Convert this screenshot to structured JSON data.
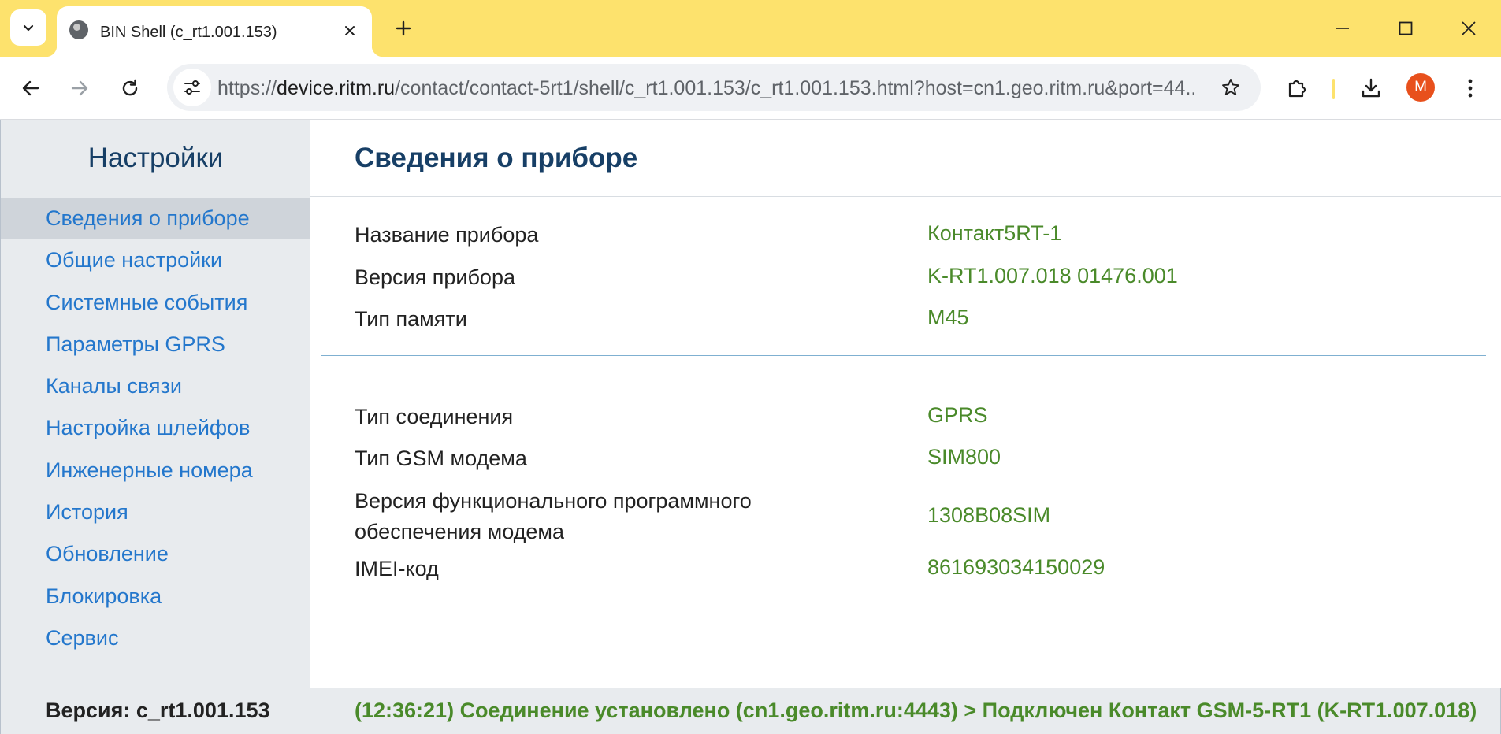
{
  "browser": {
    "tab": {
      "title": "BIN Shell (c_rt1.001.153)"
    },
    "url": {
      "scheme": "https://",
      "host": "device.ritm.ru",
      "path": "/contact/contact-5rt1/shell/c_rt1.001.153/c_rt1.001.153.html?host=cn1.geo.ritm.ru&port=44..."
    },
    "profile_initial": "M",
    "colors": {
      "frame": "#fde26d",
      "avatar": "#e8501c"
    }
  },
  "sidebar": {
    "title": "Настройки",
    "items": [
      {
        "label": "Сведения о приборе",
        "active": true
      },
      {
        "label": "Общие настройки"
      },
      {
        "label": "Системные события"
      },
      {
        "label": "Параметры GPRS"
      },
      {
        "label": "Каналы связи"
      },
      {
        "label": "Настройка шлейфов"
      },
      {
        "label": "Инженерные номера"
      },
      {
        "label": "История"
      },
      {
        "label": "Обновление"
      },
      {
        "label": "Блокировка"
      },
      {
        "label": "Сервис"
      }
    ]
  },
  "main": {
    "title": "Сведения о приборе",
    "device_info": [
      {
        "label": "Название прибора",
        "value": "Контакт5RT-1"
      },
      {
        "label": "Версия прибора",
        "value": "K-RT1.007.018 01476.001"
      },
      {
        "label": "Тип памяти",
        "value": "M45"
      }
    ],
    "modem_info": [
      {
        "label": "Тип соединения",
        "value": "GPRS"
      },
      {
        "label": "Тип GSM модема",
        "value": "SIM800"
      },
      {
        "label": "Версия функционального программного обеспечения модема",
        "value": "1308B08SIM"
      },
      {
        "label": "IMEI-код",
        "value": "861693034150029"
      }
    ]
  },
  "footer": {
    "version": "Версия: c_rt1.001.153",
    "status": "(12:36:21) Соединение установлено (cn1.geo.ritm.ru:4443) > Подключен Контакт GSM-5-RT1 (K-RT1.007.018)"
  }
}
